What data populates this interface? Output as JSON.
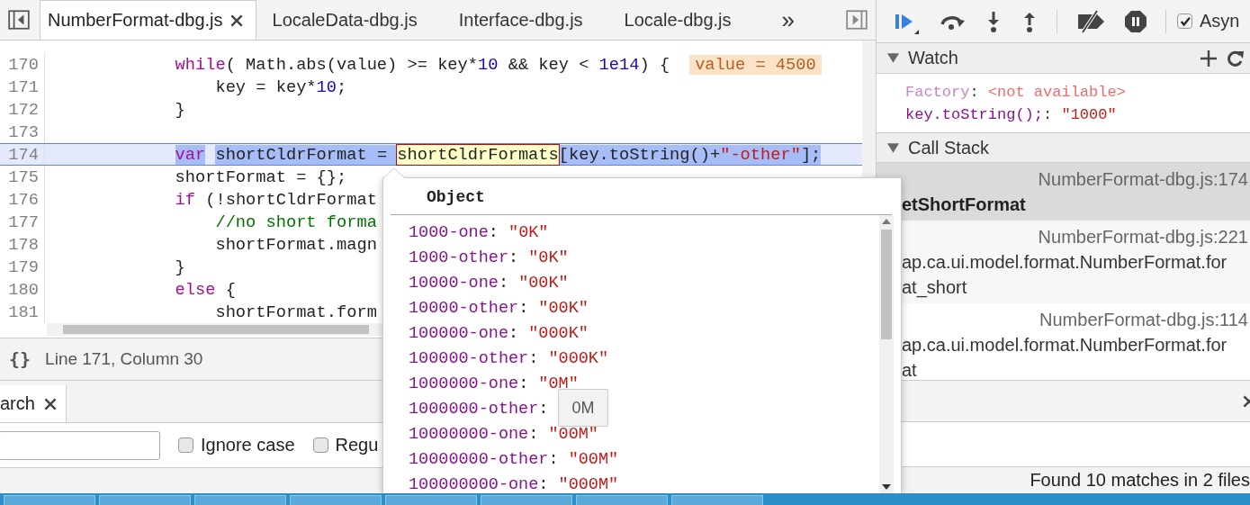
{
  "editor_tabs": [
    {
      "label": "NumberFormat-dbg.js",
      "selected": true,
      "closable": true
    },
    {
      "label": "LocaleData-dbg.js",
      "selected": false,
      "closable": false
    },
    {
      "label": "Interface-dbg.js",
      "selected": false,
      "closable": false
    },
    {
      "label": "Locale-dbg.js",
      "selected": false,
      "closable": false
    }
  ],
  "tabs_overflow": "»",
  "code_lines": [
    {
      "number": "170",
      "current": false,
      "inline_value": "value = 4500",
      "tokens": [
        {
          "text": "            while",
          "kind": "keyword"
        },
        {
          "text": "( Math.abs(value) >= key*",
          "kind": "plain"
        },
        {
          "text": "10",
          "kind": "number"
        },
        {
          "text": " && key < ",
          "kind": "plain"
        },
        {
          "text": "1e14",
          "kind": "number"
        },
        {
          "text": ") {",
          "kind": "plain"
        }
      ]
    },
    {
      "number": "171",
      "current": false,
      "tokens": [
        {
          "text": "                key = key*",
          "kind": "plain"
        },
        {
          "text": "10",
          "kind": "number"
        },
        {
          "text": ";",
          "kind": "plain"
        }
      ]
    },
    {
      "number": "172",
      "current": false,
      "tokens": [
        {
          "text": "            }",
          "kind": "plain"
        }
      ]
    },
    {
      "number": "173",
      "current": false
    },
    {
      "number": "174",
      "current": true,
      "tokens": [
        {
          "text": "            var",
          "kind": "keyword",
          "selected": true,
          "hovered": false
        },
        {
          "text": " shortCldrFormat = ",
          "kind": "plain",
          "selected": true,
          "hovered": false
        },
        {
          "text": "shortCldrFormats",
          "kind": "plain",
          "hovered": true
        },
        {
          "text": "[key.toString()+",
          "kind": "plain",
          "selected": true,
          "hovered": false
        },
        {
          "text": "\"-other\"",
          "kind": "string",
          "selected": true,
          "hovered": false
        },
        {
          "text": "];",
          "kind": "plain",
          "selected": true,
          "hovered": false
        }
      ]
    },
    {
      "number": "175",
      "current": false,
      "tokens": [
        {
          "text": "            shortFormat = {};",
          "kind": "plain"
        }
      ]
    },
    {
      "number": "176",
      "current": false,
      "tokens": [
        {
          "text": "            if",
          "kind": "keyword"
        },
        {
          "text": " (!shortCldrFormat",
          "kind": "plain"
        }
      ]
    },
    {
      "number": "177",
      "current": false,
      "tokens": [
        {
          "text": "                //no short forma",
          "kind": "comment"
        }
      ]
    },
    {
      "number": "178",
      "current": false,
      "tokens": [
        {
          "text": "                shortFormat.magn",
          "kind": "plain"
        }
      ]
    },
    {
      "number": "179",
      "current": false,
      "tokens": [
        {
          "text": "            }",
          "kind": "plain"
        }
      ]
    },
    {
      "number": "180",
      "current": false,
      "tokens": [
        {
          "text": "            else",
          "kind": "keyword"
        },
        {
          "text": " {",
          "kind": "plain"
        }
      ]
    },
    {
      "number": "181",
      "current": false,
      "tokens": [
        {
          "text": "                shortFormat.form",
          "kind": "plain"
        }
      ]
    }
  ],
  "status_bar": {
    "format_button": "{}",
    "position": "Line 171, Column 30"
  },
  "drawer": {
    "tab": {
      "label": "arch",
      "selected": true
    },
    "search_options": [
      {
        "label": "Ignore case",
        "checked": false
      },
      {
        "label": "Regu",
        "checked": false
      }
    ],
    "result": "Found 10 matches in 2 files"
  },
  "debugger": {
    "async": {
      "label": "Asyn",
      "checked": true
    },
    "watch": {
      "title": "Watch",
      "expanded": true,
      "separator": ":",
      "expressions": [
        {
          "name": "Factory",
          "value": "<not available>",
          "available": false
        },
        {
          "name": "key.toString();",
          "value": "\"1000\"",
          "available": true
        }
      ]
    },
    "call_stack": {
      "title": "Call Stack",
      "expanded": true,
      "frames": [
        {
          "location": "NumberFormat-dbg.js:174",
          "name_lines": [
            "etShortFormat"
          ],
          "selected": true
        },
        {
          "location": "NumberFormat-dbg.js:221",
          "name_lines": [
            "ap.ca.ui.model.format.NumberFormat.for",
            "at_short"
          ],
          "selected": false
        },
        {
          "location": "NumberFormat-dbg.js:114",
          "name_lines": [
            "ap.ca.ui.model.format.NumberFormat.for",
            "at"
          ],
          "selected": false
        }
      ]
    }
  },
  "popover": {
    "title": "Object",
    "separator": ":",
    "tooltip": "0M",
    "properties": [
      {
        "key": "1000-one",
        "value": "\"0K\""
      },
      {
        "key": "1000-other",
        "value": "\"0K\""
      },
      {
        "key": "10000-one",
        "value": "\"00K\""
      },
      {
        "key": "10000-other",
        "value": "\"00K\""
      },
      {
        "key": "100000-one",
        "value": "\"000K\""
      },
      {
        "key": "100000-other",
        "value": "\"000K\""
      },
      {
        "key": "1000000-one",
        "value": "\"0M\""
      },
      {
        "key": "1000000-other"
      },
      {
        "key": "10000000-one",
        "value": "\"00M\""
      },
      {
        "key": "10000000-other",
        "value": "\"00M\""
      },
      {
        "key": "100000000-one",
        "value": "\"000M\""
      }
    ]
  }
}
